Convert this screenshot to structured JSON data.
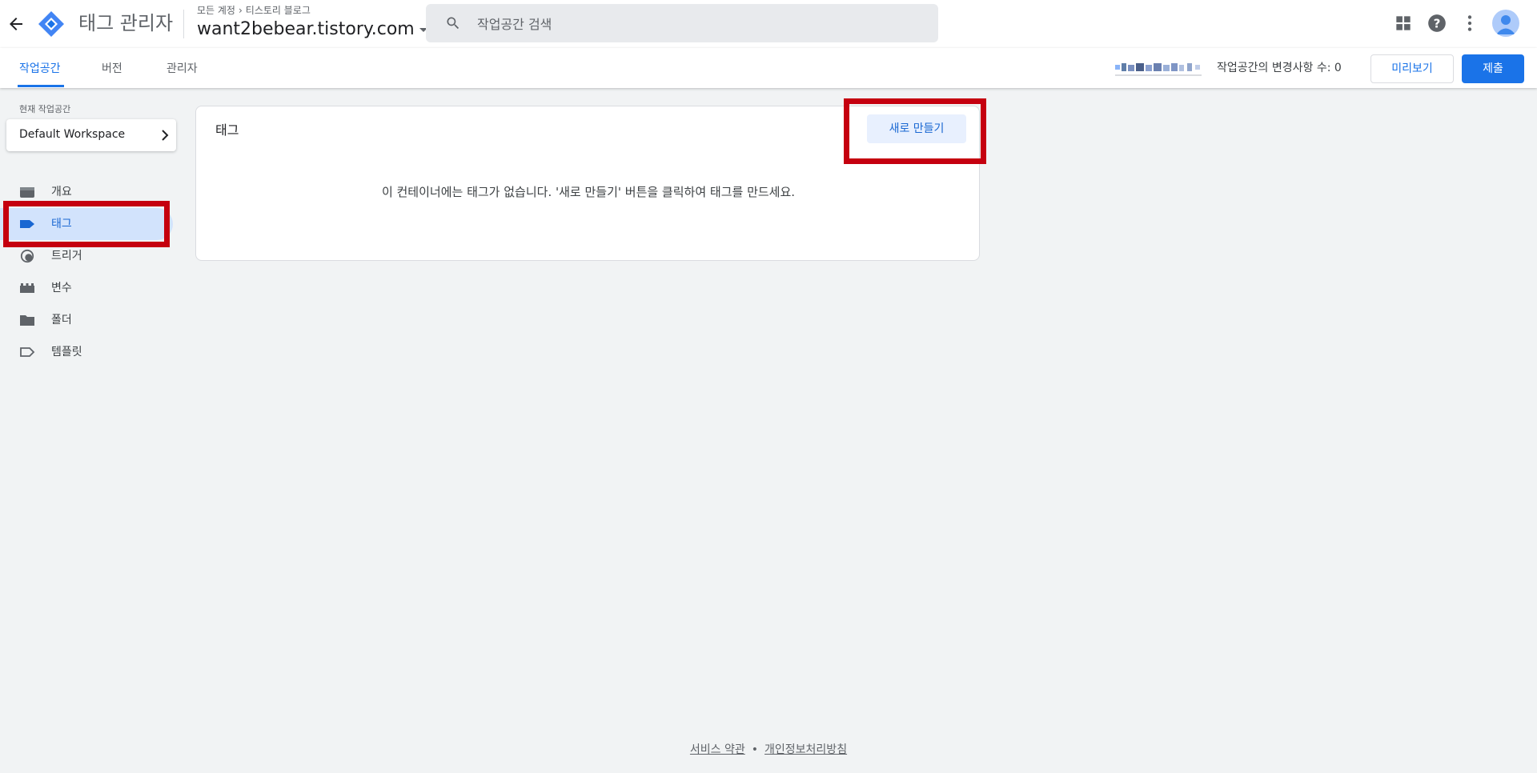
{
  "header": {
    "app_title": "태그 관리자",
    "breadcrumb": [
      "모든 계정",
      "티스토리 블로그"
    ],
    "container_name": "want2bebear.tistory.com",
    "search_placeholder": "작업공간 검색"
  },
  "nav": {
    "tabs": [
      {
        "label": "작업공간",
        "active": true
      },
      {
        "label": "버전",
        "active": false
      },
      {
        "label": "관리자",
        "active": false
      }
    ],
    "changes_label": "작업공간의 변경사항 수: 0",
    "preview_label": "미리보기",
    "submit_label": "제출"
  },
  "sidebar": {
    "workspace_label": "현재 작업공간",
    "workspace_name": "Default Workspace",
    "items": [
      {
        "label": "개요",
        "icon": "overview-icon"
      },
      {
        "label": "태그",
        "icon": "tag-icon",
        "active": true
      },
      {
        "label": "트리거",
        "icon": "trigger-icon"
      },
      {
        "label": "변수",
        "icon": "variable-icon"
      },
      {
        "label": "폴더",
        "icon": "folder-icon"
      },
      {
        "label": "템플릿",
        "icon": "template-icon"
      }
    ]
  },
  "main": {
    "card_title": "태그",
    "new_button": "새로 만들기",
    "empty_message": "이 컨테이너에는 태그가 없습니다. '새로 만들기' 버튼을 클릭하여 태그를 만드세요."
  },
  "footer": {
    "terms": "서비스 약관",
    "privacy": "개인정보처리방침"
  },
  "colors": {
    "accent": "#1a73e8",
    "highlight": "#c5000f",
    "active_bg": "#d2e3fc"
  }
}
